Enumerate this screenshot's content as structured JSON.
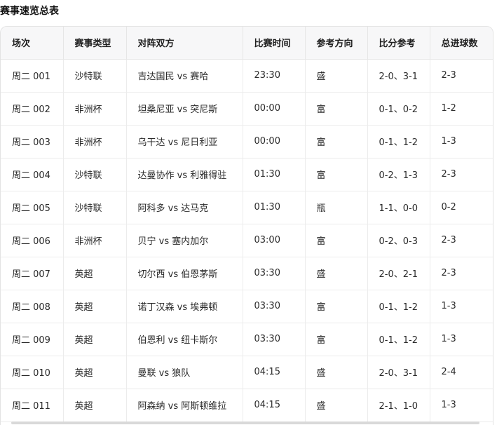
{
  "title": "赛事速览总表",
  "table": {
    "headers": [
      "场次",
      "赛事类型",
      "对阵双方",
      "比赛时间",
      "参考方向",
      "比分参考",
      "总进球数"
    ],
    "rows": [
      [
        "周二 001",
        "沙特联",
        "吉达国民 vs 赛哈",
        "23:30",
        "盛",
        "2-0、3-1",
        "2-3"
      ],
      [
        "周二 002",
        "非洲杯",
        "坦桑尼亚 vs 突尼斯",
        "00:00",
        "富",
        "0-1、0-2",
        "1-2"
      ],
      [
        "周二 003",
        "非洲杯",
        "乌干达 vs 尼日利亚",
        "00:00",
        "富",
        "0-1、1-2",
        "1-3"
      ],
      [
        "周二 004",
        "沙特联",
        "达曼协作 vs 利雅得驻",
        "01:30",
        "富",
        "0-2、1-3",
        "2-3"
      ],
      [
        "周二 005",
        "沙特联",
        "阿科多 vs 达马克",
        "01:30",
        "瓶",
        "1-1、0-0",
        "0-2"
      ],
      [
        "周二 006",
        "非洲杯",
        "贝宁 vs 塞内加尔",
        "03:00",
        "富",
        "0-2、0-3",
        "2-3"
      ],
      [
        "周二 007",
        "英超",
        "切尔西 vs 伯恩茅斯",
        "03:30",
        "盛",
        "2-0、2-1",
        "2-3"
      ],
      [
        "周二 008",
        "英超",
        "诺丁汉森 vs 埃弗顿",
        "03:30",
        "富",
        "0-1、1-2",
        "1-3"
      ],
      [
        "周二 009",
        "英超",
        "伯恩利 vs 纽卡斯尔",
        "03:30",
        "富",
        "0-1、1-2",
        "1-3"
      ],
      [
        "周二 010",
        "英超",
        "曼联 vs 狼队",
        "04:15",
        "盛",
        "2-0、3-1",
        "2-4"
      ],
      [
        "周二 011",
        "英超",
        "阿森纳 vs 阿斯顿维拉",
        "04:15",
        "盛",
        "2-1、1-0",
        "1-3"
      ]
    ]
  }
}
